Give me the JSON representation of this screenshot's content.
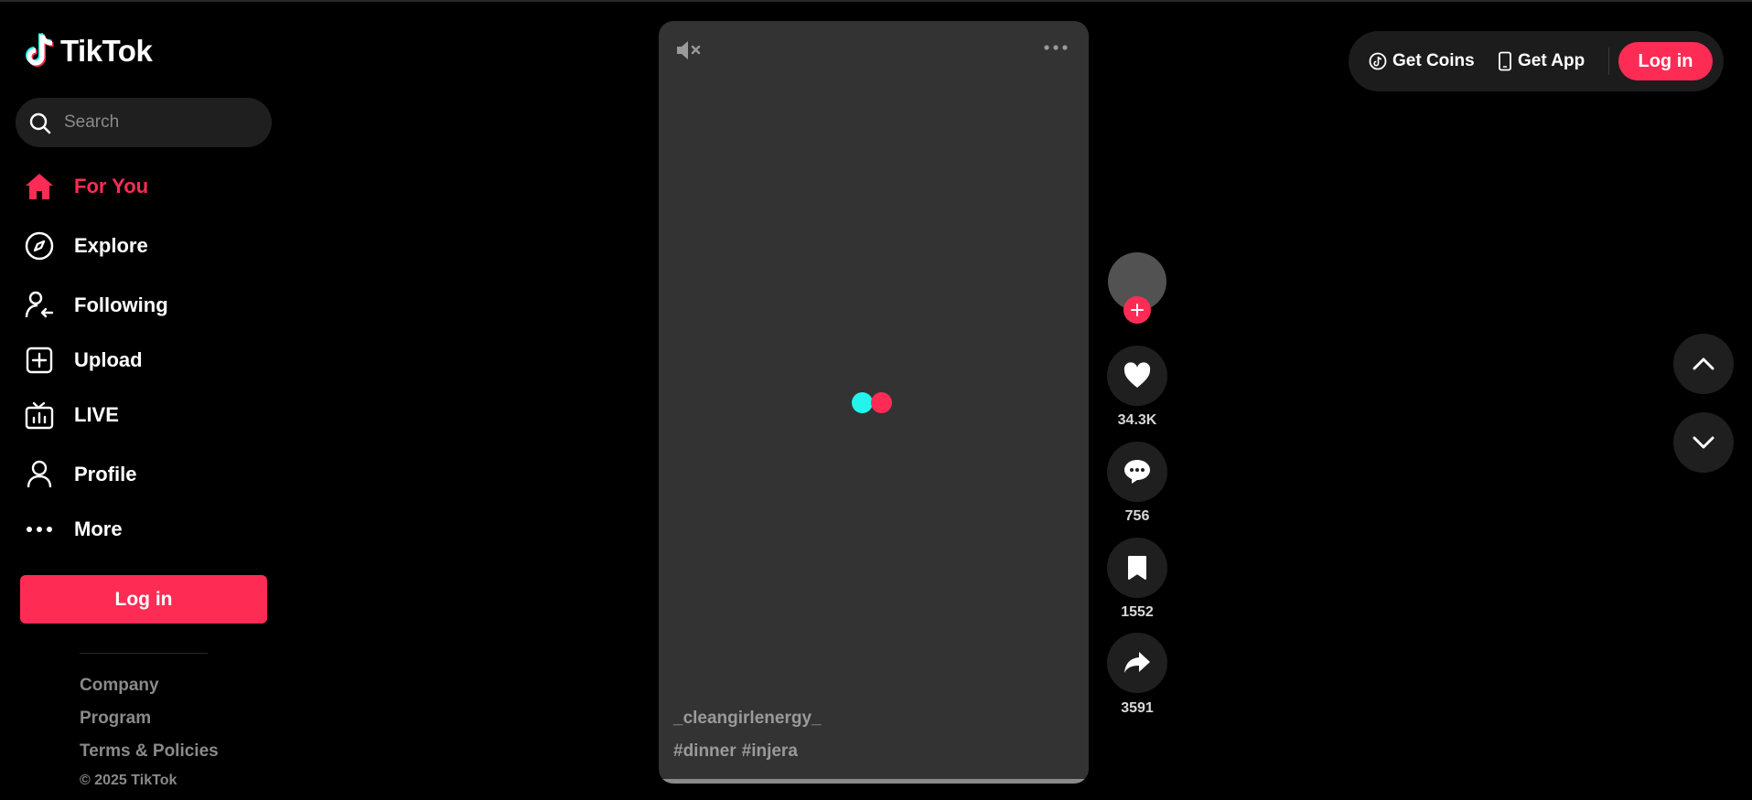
{
  "app": {
    "logo_text": "TikTok"
  },
  "search": {
    "placeholder": "Search"
  },
  "sidebar": {
    "items": [
      {
        "label": "For You",
        "icon": "home-icon",
        "active": true
      },
      {
        "label": "Explore",
        "icon": "compass-icon"
      },
      {
        "label": "Following",
        "icon": "following-icon"
      },
      {
        "label": "Upload",
        "icon": "upload-icon"
      },
      {
        "label": "LIVE",
        "icon": "live-tv-icon"
      },
      {
        "label": "Profile",
        "icon": "profile-icon"
      },
      {
        "label": "More",
        "icon": "more-dots-icon"
      }
    ],
    "login_label": "Log in",
    "footer": {
      "links": [
        "Company",
        "Program",
        "Terms & Policies"
      ],
      "copyright": "© 2025 TikTok"
    }
  },
  "video": {
    "username": "_cleangirlenergy_",
    "tags": [
      "#dinner",
      "#injera"
    ],
    "muted": true
  },
  "actions": {
    "likes": "34.3K",
    "comments": "756",
    "saves": "1552",
    "shares": "3591"
  },
  "topbar": {
    "get_coins": "Get Coins",
    "get_app": "Get App",
    "login_label": "Log in"
  },
  "colors": {
    "accent": "#fe2c55",
    "cyan": "#25f4ee",
    "background": "#000000",
    "video_bg": "#333333"
  }
}
